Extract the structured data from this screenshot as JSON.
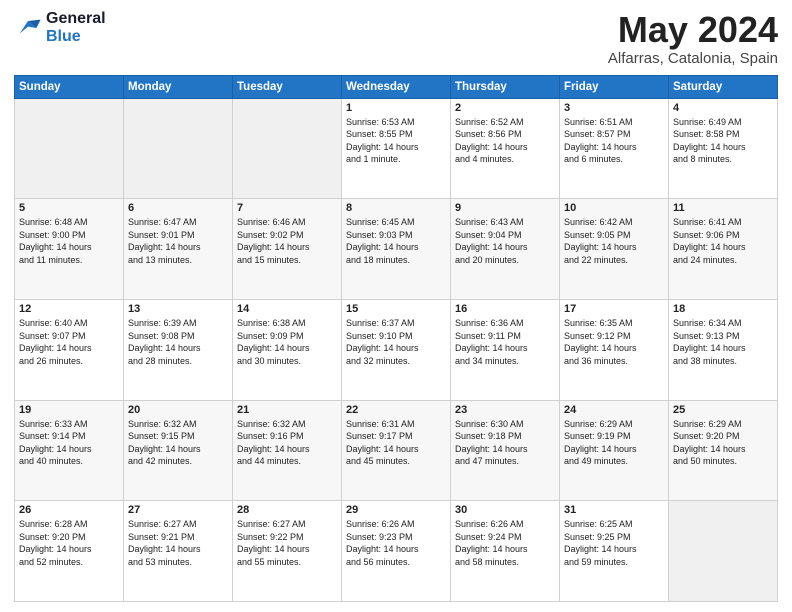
{
  "logo": {
    "line1": "General",
    "line2": "Blue"
  },
  "title": "May 2024",
  "location": "Alfarras, Catalonia, Spain",
  "days_of_week": [
    "Sunday",
    "Monday",
    "Tuesday",
    "Wednesday",
    "Thursday",
    "Friday",
    "Saturday"
  ],
  "weeks": [
    [
      {
        "day": "",
        "info": ""
      },
      {
        "day": "",
        "info": ""
      },
      {
        "day": "",
        "info": ""
      },
      {
        "day": "1",
        "info": "Sunrise: 6:53 AM\nSunset: 8:55 PM\nDaylight: 14 hours\nand 1 minute."
      },
      {
        "day": "2",
        "info": "Sunrise: 6:52 AM\nSunset: 8:56 PM\nDaylight: 14 hours\nand 4 minutes."
      },
      {
        "day": "3",
        "info": "Sunrise: 6:51 AM\nSunset: 8:57 PM\nDaylight: 14 hours\nand 6 minutes."
      },
      {
        "day": "4",
        "info": "Sunrise: 6:49 AM\nSunset: 8:58 PM\nDaylight: 14 hours\nand 8 minutes."
      }
    ],
    [
      {
        "day": "5",
        "info": "Sunrise: 6:48 AM\nSunset: 9:00 PM\nDaylight: 14 hours\nand 11 minutes."
      },
      {
        "day": "6",
        "info": "Sunrise: 6:47 AM\nSunset: 9:01 PM\nDaylight: 14 hours\nand 13 minutes."
      },
      {
        "day": "7",
        "info": "Sunrise: 6:46 AM\nSunset: 9:02 PM\nDaylight: 14 hours\nand 15 minutes."
      },
      {
        "day": "8",
        "info": "Sunrise: 6:45 AM\nSunset: 9:03 PM\nDaylight: 14 hours\nand 18 minutes."
      },
      {
        "day": "9",
        "info": "Sunrise: 6:43 AM\nSunset: 9:04 PM\nDaylight: 14 hours\nand 20 minutes."
      },
      {
        "day": "10",
        "info": "Sunrise: 6:42 AM\nSunset: 9:05 PM\nDaylight: 14 hours\nand 22 minutes."
      },
      {
        "day": "11",
        "info": "Sunrise: 6:41 AM\nSunset: 9:06 PM\nDaylight: 14 hours\nand 24 minutes."
      }
    ],
    [
      {
        "day": "12",
        "info": "Sunrise: 6:40 AM\nSunset: 9:07 PM\nDaylight: 14 hours\nand 26 minutes."
      },
      {
        "day": "13",
        "info": "Sunrise: 6:39 AM\nSunset: 9:08 PM\nDaylight: 14 hours\nand 28 minutes."
      },
      {
        "day": "14",
        "info": "Sunrise: 6:38 AM\nSunset: 9:09 PM\nDaylight: 14 hours\nand 30 minutes."
      },
      {
        "day": "15",
        "info": "Sunrise: 6:37 AM\nSunset: 9:10 PM\nDaylight: 14 hours\nand 32 minutes."
      },
      {
        "day": "16",
        "info": "Sunrise: 6:36 AM\nSunset: 9:11 PM\nDaylight: 14 hours\nand 34 minutes."
      },
      {
        "day": "17",
        "info": "Sunrise: 6:35 AM\nSunset: 9:12 PM\nDaylight: 14 hours\nand 36 minutes."
      },
      {
        "day": "18",
        "info": "Sunrise: 6:34 AM\nSunset: 9:13 PM\nDaylight: 14 hours\nand 38 minutes."
      }
    ],
    [
      {
        "day": "19",
        "info": "Sunrise: 6:33 AM\nSunset: 9:14 PM\nDaylight: 14 hours\nand 40 minutes."
      },
      {
        "day": "20",
        "info": "Sunrise: 6:32 AM\nSunset: 9:15 PM\nDaylight: 14 hours\nand 42 minutes."
      },
      {
        "day": "21",
        "info": "Sunrise: 6:32 AM\nSunset: 9:16 PM\nDaylight: 14 hours\nand 44 minutes."
      },
      {
        "day": "22",
        "info": "Sunrise: 6:31 AM\nSunset: 9:17 PM\nDaylight: 14 hours\nand 45 minutes."
      },
      {
        "day": "23",
        "info": "Sunrise: 6:30 AM\nSunset: 9:18 PM\nDaylight: 14 hours\nand 47 minutes."
      },
      {
        "day": "24",
        "info": "Sunrise: 6:29 AM\nSunset: 9:19 PM\nDaylight: 14 hours\nand 49 minutes."
      },
      {
        "day": "25",
        "info": "Sunrise: 6:29 AM\nSunset: 9:20 PM\nDaylight: 14 hours\nand 50 minutes."
      }
    ],
    [
      {
        "day": "26",
        "info": "Sunrise: 6:28 AM\nSunset: 9:20 PM\nDaylight: 14 hours\nand 52 minutes."
      },
      {
        "day": "27",
        "info": "Sunrise: 6:27 AM\nSunset: 9:21 PM\nDaylight: 14 hours\nand 53 minutes."
      },
      {
        "day": "28",
        "info": "Sunrise: 6:27 AM\nSunset: 9:22 PM\nDaylight: 14 hours\nand 55 minutes."
      },
      {
        "day": "29",
        "info": "Sunrise: 6:26 AM\nSunset: 9:23 PM\nDaylight: 14 hours\nand 56 minutes."
      },
      {
        "day": "30",
        "info": "Sunrise: 6:26 AM\nSunset: 9:24 PM\nDaylight: 14 hours\nand 58 minutes."
      },
      {
        "day": "31",
        "info": "Sunrise: 6:25 AM\nSunset: 9:25 PM\nDaylight: 14 hours\nand 59 minutes."
      },
      {
        "day": "",
        "info": ""
      }
    ]
  ]
}
